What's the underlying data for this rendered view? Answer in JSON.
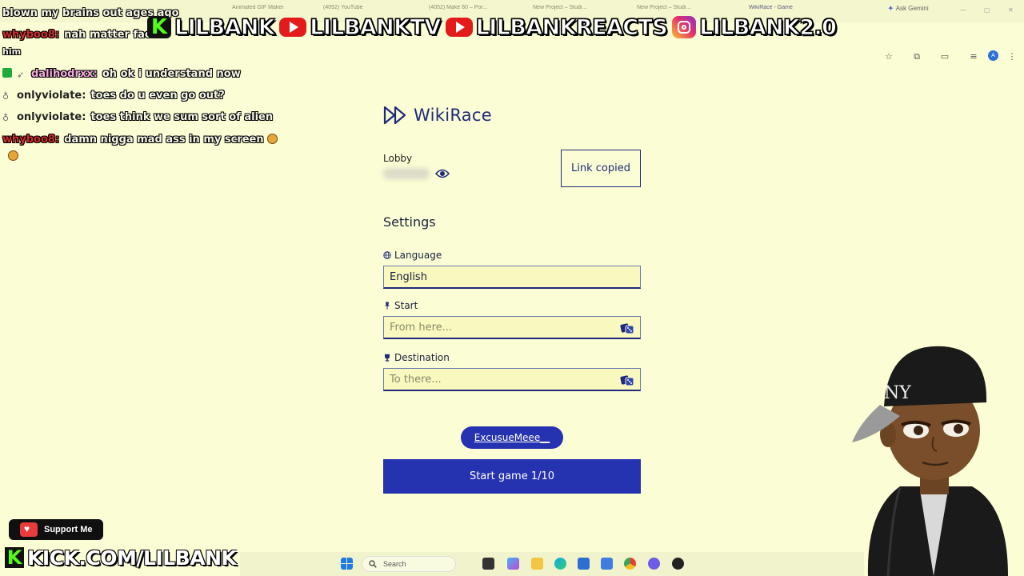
{
  "browser": {
    "tabs": [
      {
        "label": "Animated GIF Maker",
        "active": false
      },
      {
        "label": "(4052) YouTube",
        "active": false
      },
      {
        "label": "(4052) Make 60 – Por...",
        "active": false
      },
      {
        "label": "New Project – Studi...",
        "active": false
      },
      {
        "label": "New Project – Studi...",
        "active": false
      },
      {
        "label": "WikiRace - Game",
        "active": true
      }
    ],
    "ask_gemini": "Ask Gemini",
    "profile_initial": "A"
  },
  "stream_banner": {
    "kick": "LILBANK",
    "youtube_main": "LILBANKTV",
    "youtube_reacts": "LILBANKREACTS",
    "instagram": "LILBANK2.0",
    "colors": {
      "kick": "#53fc18",
      "youtube": "#e31b1b"
    }
  },
  "chat": [
    {
      "user": "",
      "text": "blown my brains out ages ago",
      "user_color": "#f6f6e8",
      "badge": "none"
    },
    {
      "user": "whyboo8:",
      "text": "nah matter fac",
      "user_color": "#d12c2c",
      "badge": "none"
    },
    {
      "user": "",
      "text": "him",
      "user_color": "#f6f6e8",
      "badge": "none"
    },
    {
      "user": "dalihodrxx:",
      "text": "oh ok i understand now",
      "user_color": "#f3a9dd",
      "badge": "green"
    },
    {
      "user": "onlyviolate:",
      "text": "toes do u even go out?",
      "user_color": "#222222",
      "badge": "drop"
    },
    {
      "user": "onlyviolate:",
      "text": "toes think we sum sort of alien",
      "user_color": "#222222",
      "badge": "drop"
    },
    {
      "user": "whyboo8:",
      "text": "damn nigga mad ass in my screen",
      "user_color": "#d12c2c",
      "badge": "none"
    }
  ],
  "app": {
    "title": "WikiRace",
    "lobby_label": "Lobby",
    "lobby_code": "ab7d2c",
    "link_copied": "Link copied",
    "settings_title": "Settings",
    "language_label": "Language",
    "language_value": "English",
    "start_label": "Start",
    "start_placeholder": "From here...",
    "destination_label": "Destination",
    "destination_placeholder": "To there...",
    "player_name": "ExcusueMeee__",
    "start_button": "Start game 1/10",
    "accent_color": "#2633b0"
  },
  "overlay": {
    "support_label": "Support Me",
    "kick_url": "KICK.COM/LILBANK"
  },
  "taskbar": {
    "search_placeholder": "Search"
  }
}
